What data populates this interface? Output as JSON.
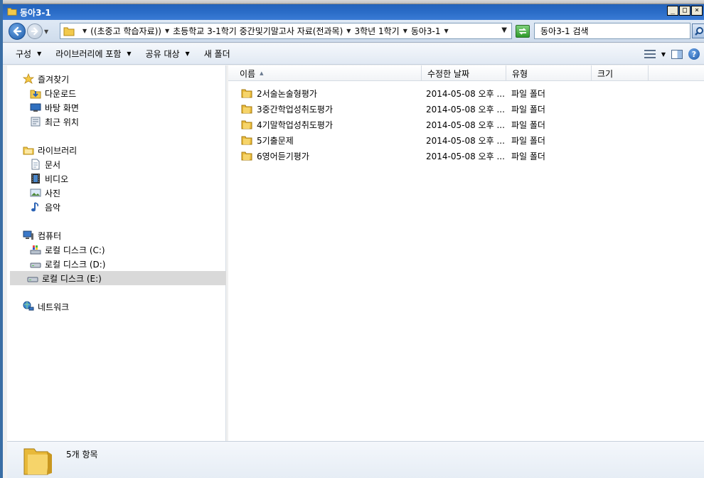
{
  "window": {
    "title": "동아3-1",
    "controls": {
      "minimize": "_",
      "maximize": "□",
      "close": "×"
    }
  },
  "address": {
    "crumbs": [
      "((초중고 학습자료))",
      "초등학교 3-1학기 중간및기말고사 자료(전과목)",
      "3학년 1학기",
      "동아3-1"
    ],
    "search_placeholder": "동아3-1 검색"
  },
  "toolbar": {
    "organize": "구성",
    "include_in_library": "라이브러리에 포함",
    "share_with": "공유 대상",
    "new_folder": "새 폴더"
  },
  "sidebar": {
    "favorites": {
      "label": "즐겨찾기",
      "items": [
        "다운로드",
        "바탕 화면",
        "최근 위치"
      ]
    },
    "libraries": {
      "label": "라이브러리",
      "items": [
        "문서",
        "비디오",
        "사진",
        "음악"
      ]
    },
    "computer": {
      "label": "컴퓨터",
      "items": [
        "로컬 디스크 (C:)",
        "로컬 디스크 (D:)",
        "로컬 디스크 (E:)"
      ],
      "selected": "로컬 디스크 (E:)"
    },
    "network": {
      "label": "네트워크"
    }
  },
  "file_list": {
    "columns": {
      "name": "이름",
      "modified": "수정한 날짜",
      "type": "유형",
      "size": "크기"
    },
    "rows": [
      {
        "name": "2서술논술형평가",
        "modified": "2014-05-08 오후 ...",
        "type": "파일 폴더",
        "size": ""
      },
      {
        "name": "3중간학업성취도평가",
        "modified": "2014-05-08 오후 ...",
        "type": "파일 폴더",
        "size": ""
      },
      {
        "name": "4기말학업성취도평가",
        "modified": "2014-05-08 오후 ...",
        "type": "파일 폴더",
        "size": ""
      },
      {
        "name": "5기출문제",
        "modified": "2014-05-08 오후 ...",
        "type": "파일 폴더",
        "size": ""
      },
      {
        "name": "6영어듣기평가",
        "modified": "2014-05-08 오후 ...",
        "type": "파일 폴더",
        "size": ""
      }
    ]
  },
  "status": {
    "item_count": "5개 항목"
  },
  "colors": {
    "folder": "#e8b93a",
    "selection": "#d9d9d9",
    "title_bar": "#2a6cc7"
  }
}
